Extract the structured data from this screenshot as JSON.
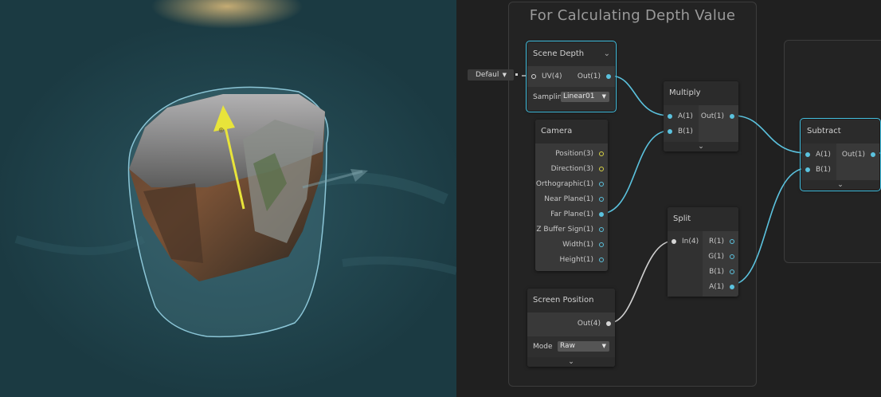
{
  "group": {
    "title": "For Calculating Depth Value"
  },
  "nodes": {
    "scene_depth": {
      "title": "Scene Depth",
      "in_uv": "UV(4)",
      "out": "Out(1)",
      "sampling_label": "Samplin",
      "sampling_value": "Linear01",
      "uv_default": "Defaul"
    },
    "camera": {
      "title": "Camera",
      "ports": [
        "Position(3)",
        "Direction(3)",
        "Orthographic(1)",
        "Near Plane(1)",
        "Far Plane(1)",
        "Z Buffer Sign(1)",
        "Width(1)",
        "Height(1)"
      ]
    },
    "multiply": {
      "title": "Multiply",
      "in_a": "A(1)",
      "in_b": "B(1)",
      "out": "Out(1)"
    },
    "split": {
      "title": "Split",
      "in": "In(4)",
      "outs": [
        "R(1)",
        "G(1)",
        "B(1)",
        "A(1)"
      ]
    },
    "screen_position": {
      "title": "Screen Position",
      "out": "Out(4)",
      "mode_label": "Mode",
      "mode_value": "Raw"
    },
    "subtract": {
      "title": "Subtract",
      "in_a": "A(1)",
      "in_b": "B(1)",
      "out": "Out(1)"
    }
  },
  "glyphs": {
    "chevron": "⌄",
    "dropdown_arrow": "▼"
  },
  "colors": {
    "wire_float": "#5bc2de",
    "wire_vector4": "#d0d0d0",
    "selection": "#44c0e0",
    "gizmo": "#e8e43a",
    "water": "#22464f"
  }
}
